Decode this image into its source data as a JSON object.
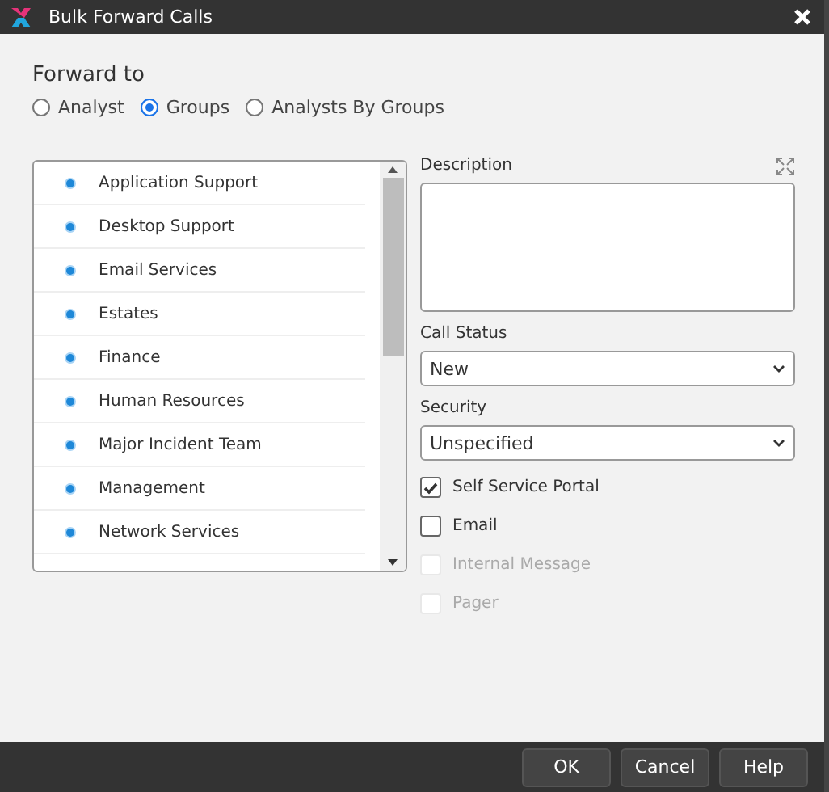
{
  "window": {
    "title": "Bulk Forward Calls"
  },
  "forward_to": {
    "label": "Forward to",
    "options": [
      {
        "label": "Analyst",
        "selected": false
      },
      {
        "label": "Groups",
        "selected": true
      },
      {
        "label": "Analysts By Groups",
        "selected": false
      }
    ]
  },
  "groups": [
    "Application Support",
    "Desktop Support",
    "Email Services",
    "Estates",
    "Finance",
    "Human Resources",
    "Major Incident Team",
    "Management",
    "Network Services"
  ],
  "description": {
    "label": "Description"
  },
  "call_status": {
    "label": "Call Status",
    "value": "New"
  },
  "security": {
    "label": "Security",
    "value": "Unspecified"
  },
  "notify": [
    {
      "label": "Self Service Portal",
      "checked": true,
      "disabled": false
    },
    {
      "label": "Email",
      "checked": false,
      "disabled": false
    },
    {
      "label": "Internal Message",
      "checked": false,
      "disabled": true
    },
    {
      "label": "Pager",
      "checked": false,
      "disabled": true
    }
  ],
  "buttons": [
    "OK",
    "Cancel",
    "Help"
  ]
}
